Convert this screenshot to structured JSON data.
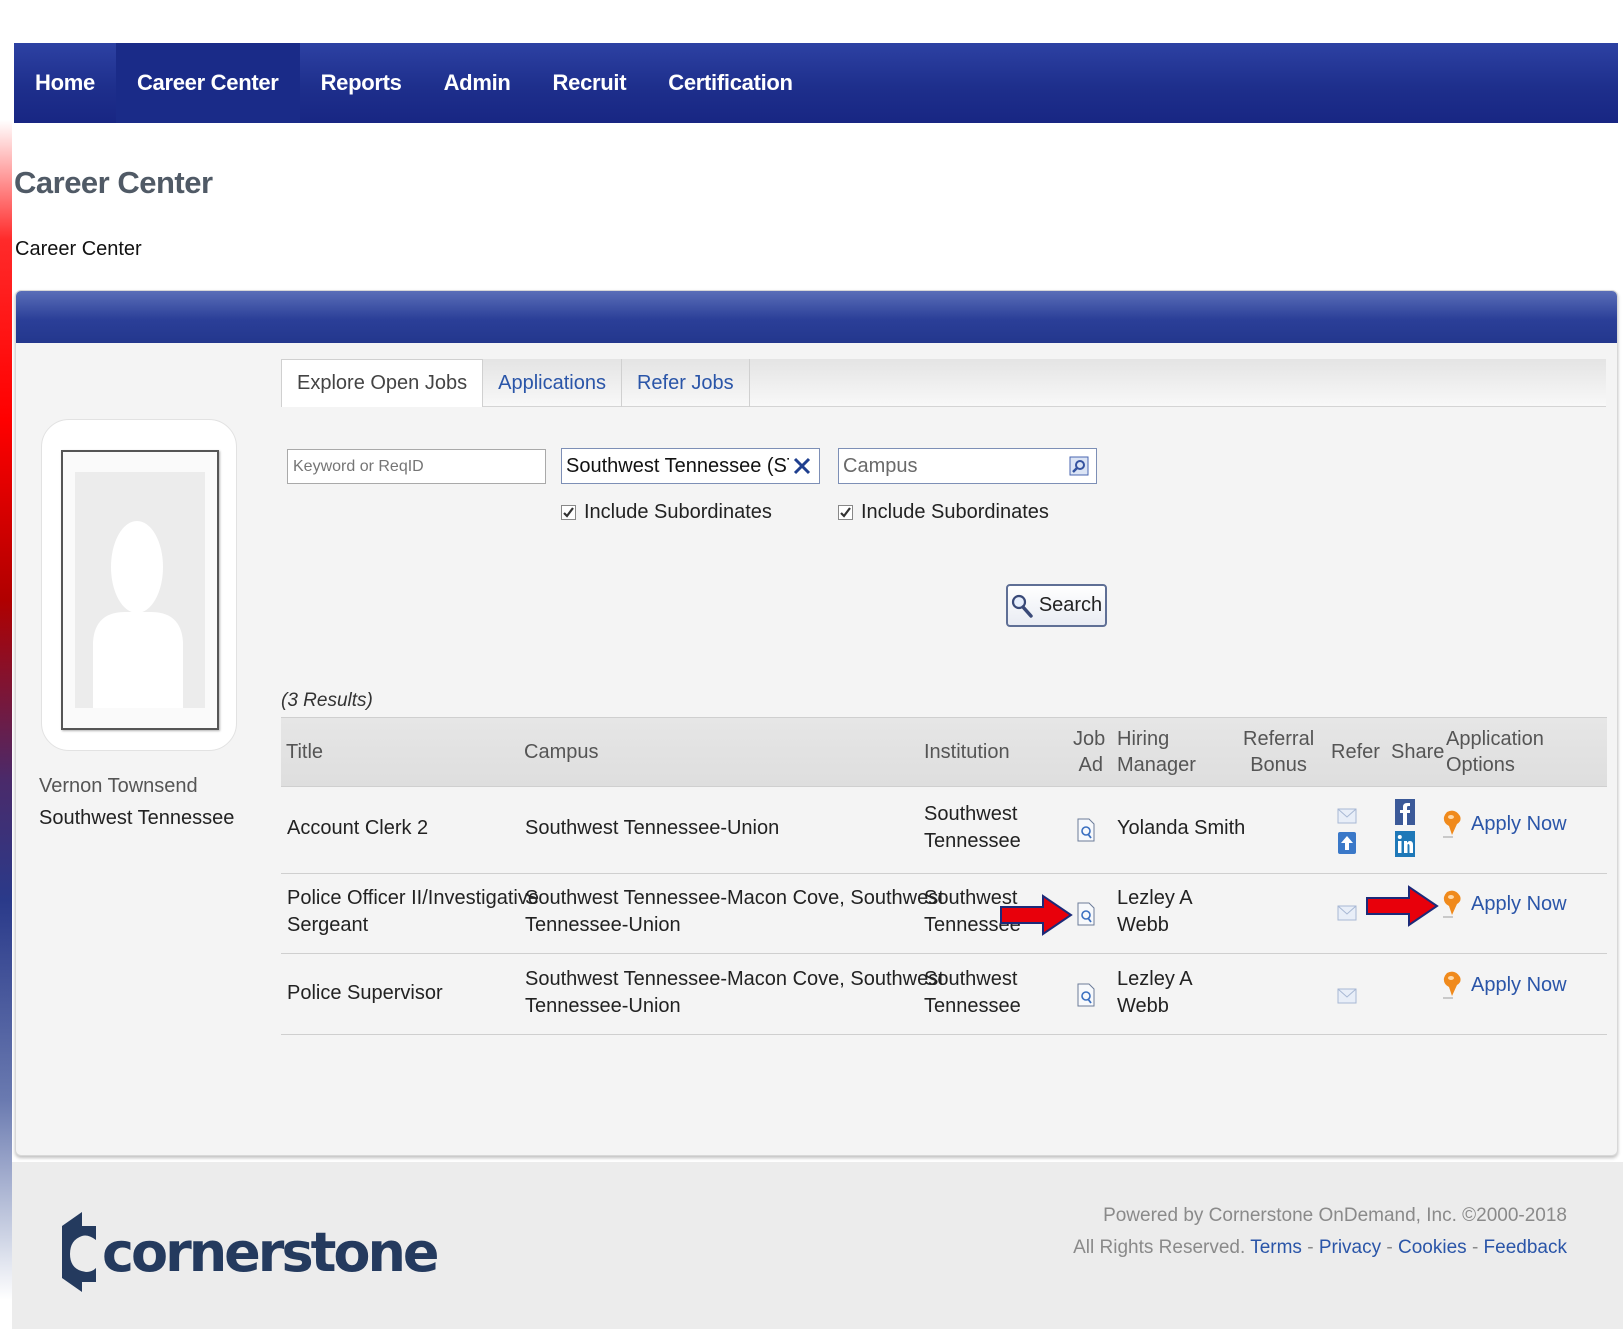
{
  "nav": {
    "items": [
      {
        "label": "Home",
        "active": false
      },
      {
        "label": "Career Center",
        "active": true
      },
      {
        "label": "Reports",
        "active": false
      },
      {
        "label": "Admin",
        "active": false
      },
      {
        "label": "Recruit",
        "active": false
      },
      {
        "label": "Certification",
        "active": false
      }
    ]
  },
  "page": {
    "title": "Career Center",
    "breadcrumb": "Career Center"
  },
  "user": {
    "name": "Vernon Townsend",
    "organization": "Southwest Tennessee"
  },
  "tabs": [
    {
      "label": "Explore Open Jobs",
      "active": true
    },
    {
      "label": "Applications",
      "active": false
    },
    {
      "label": "Refer Jobs",
      "active": false
    }
  ],
  "filters": {
    "keyword_placeholder": "Keyword or ReqID",
    "keyword_value": "",
    "institution_value": "Southwest Tennessee (STCC)",
    "campus_placeholder": "Campus",
    "include_subordinates_label": "Include Subordinates",
    "include_subordinates_institution": true,
    "include_subordinates_campus": true,
    "search_label": "Search"
  },
  "results": {
    "count_label": "(3 Results)",
    "columns": {
      "title": "Title",
      "campus": "Campus",
      "institution": "Institution",
      "job_ad_1": "Job",
      "job_ad_2": "Ad",
      "hiring_manager_1": "Hiring",
      "hiring_manager_2": "Manager",
      "referral_bonus_1": "Referral",
      "referral_bonus_2": "Bonus",
      "refer": "Refer",
      "share": "Share",
      "application_options_1": "Application",
      "application_options_2": "Options"
    },
    "rows": [
      {
        "title_1": "Account Clerk 2",
        "title_2": "",
        "campus_1": "Southwest Tennessee-Union",
        "campus_2": "",
        "institution_1": "Southwest",
        "institution_2": "Tennessee",
        "hiring_manager_1": "Yolanda Smith",
        "hiring_manager_2": "",
        "apply_label": "Apply Now"
      },
      {
        "title_1": "Police Officer II/Investigative",
        "title_2": "Sergeant",
        "campus_1": "Southwest Tennessee-Macon Cove, Southwest",
        "campus_2": "Tennessee-Union",
        "institution_1": "Southwest",
        "institution_2": "Tennessee",
        "hiring_manager_1": "Lezley A",
        "hiring_manager_2": "Webb",
        "apply_label": "Apply Now"
      },
      {
        "title_1": "Police Supervisor",
        "title_2": "",
        "campus_1": "Southwest Tennessee-Macon Cove, Southwest",
        "campus_2": "Tennessee-Union",
        "institution_1": "Southwest",
        "institution_2": "Tennessee",
        "hiring_manager_1": "Lezley A",
        "hiring_manager_2": "Webb",
        "apply_label": "Apply Now"
      }
    ]
  },
  "footer": {
    "logo_text": "cornerstone",
    "powered_by": "Powered by Cornerstone OnDemand, Inc. ©2000-2018",
    "rights": "All Rights Reserved.",
    "links": [
      "Terms",
      "Privacy",
      "Cookies",
      "Feedback"
    ],
    "separator": "-"
  },
  "colors": {
    "nav_blue": "#1e2f8c",
    "link_blue": "#2a55a8",
    "arrow_red": "#e8000b",
    "apply_orange": "#f08a1c"
  },
  "icons": [
    "search-icon",
    "clear-x-icon",
    "lookup-icon",
    "job-ad-icon",
    "email-icon",
    "refer-upload-icon",
    "facebook-icon",
    "linkedin-icon",
    "apply-pin-icon",
    "red-arrow-icon"
  ]
}
